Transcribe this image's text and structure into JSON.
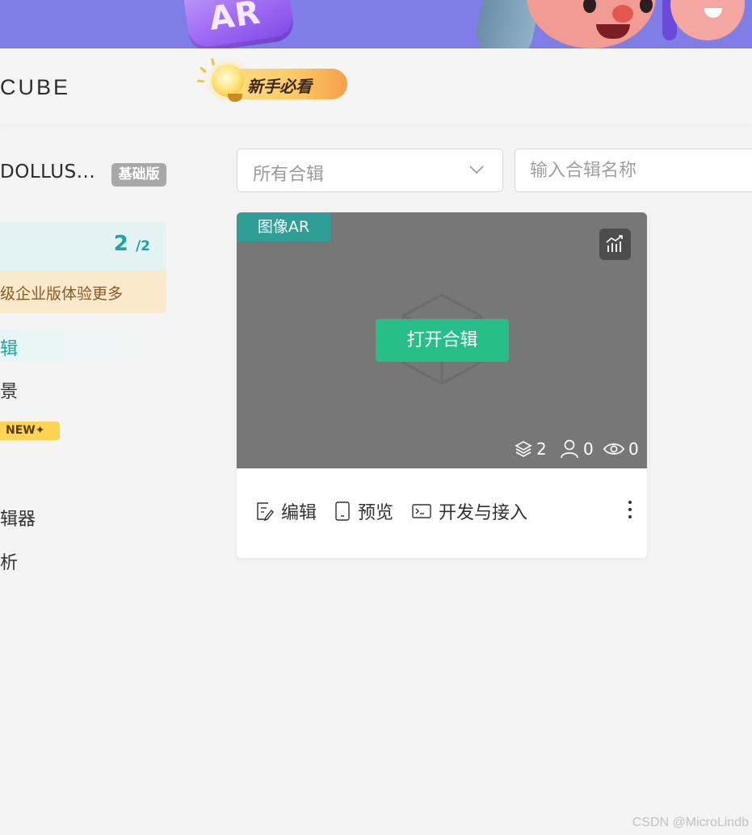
{
  "banner": {
    "badge_text": "AR"
  },
  "header": {
    "logo_text": "CUBE",
    "guide_label": "新手必看"
  },
  "sidebar": {
    "user_name": "DOLLUS...",
    "plan_badge": "基础版",
    "quota": {
      "used": "2",
      "total": "/2"
    },
    "upgrade_text": "级企业版体验更多",
    "nav": [
      {
        "label": "辑",
        "active": true
      },
      {
        "label": "景",
        "active": false
      },
      {
        "label": "NEW✦",
        "active": false
      },
      {
        "label": "辑器",
        "active": false
      },
      {
        "label": "析",
        "active": false
      }
    ]
  },
  "filters": {
    "collection_select": "所有合辑",
    "search_placeholder": "输入合辑名称"
  },
  "card": {
    "type_tag": "图像AR",
    "open_label": "打开合辑",
    "layers_count": "2",
    "users_count": "0",
    "views_count": "0",
    "actions": {
      "edit": "编辑",
      "preview": "预览",
      "develop": "开发与接入"
    }
  },
  "watermark": "CSDN @MicroLindb",
  "colors": {
    "accent_teal": "#1aa6a0",
    "open_button": "#27be8a",
    "banner": "#7f7ee6",
    "cover": "#777777"
  }
}
